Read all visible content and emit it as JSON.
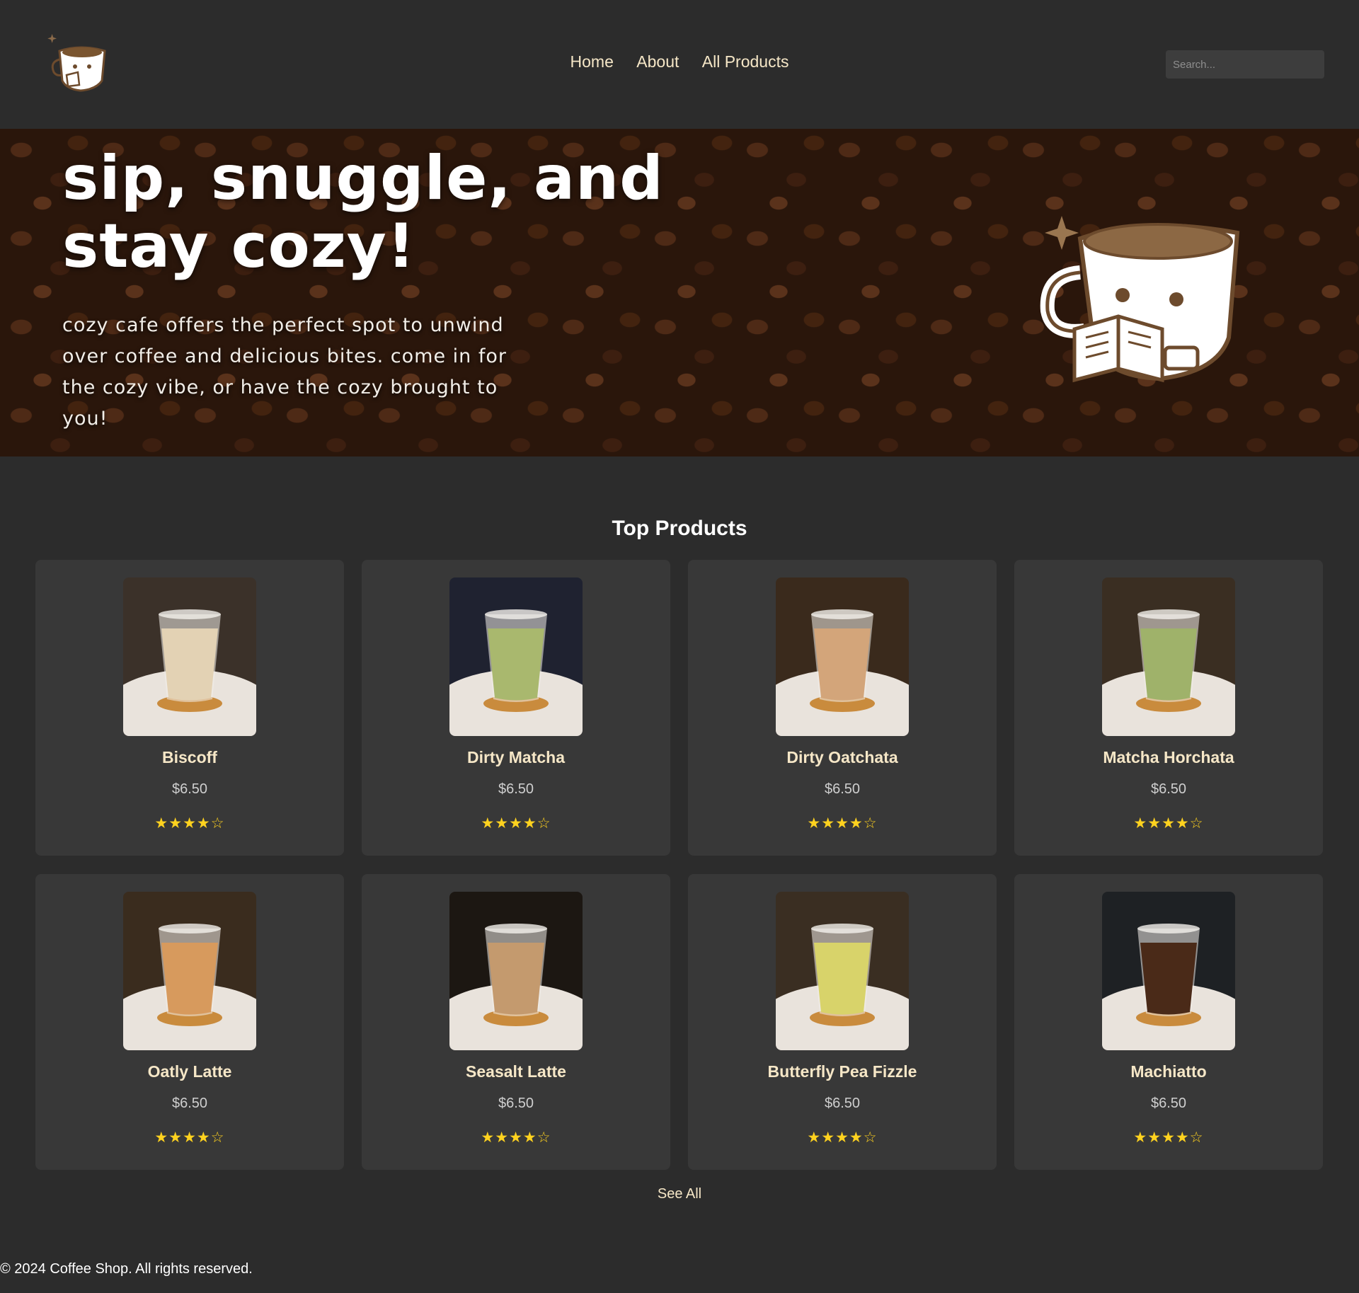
{
  "nav": {
    "items": [
      "Home",
      "About",
      "All Products"
    ]
  },
  "search": {
    "placeholder": "Search..."
  },
  "hero": {
    "title": "sip, snuggle, and stay cozy!",
    "text": "cozy cafe offers the perfect spot to unwind over coffee and delicious bites. come in for the cozy vibe, or have the cozy brought to you!"
  },
  "products": {
    "title": "Top Products",
    "items": [
      {
        "name": "Biscoff",
        "price": "$6.50",
        "rating": 4,
        "drink_color": "#e3d2b4",
        "bg": "#3b3129"
      },
      {
        "name": "Dirty Matcha",
        "price": "$6.50",
        "rating": 4,
        "drink_color": "#a9b86e",
        "bg": "#1f2230"
      },
      {
        "name": "Dirty Oatchata",
        "price": "$6.50",
        "rating": 4,
        "drink_color": "#d3a57a",
        "bg": "#3a2a1c"
      },
      {
        "name": "Matcha Horchata",
        "price": "$6.50",
        "rating": 4,
        "drink_color": "#9fb26a",
        "bg": "#3a2e22"
      },
      {
        "name": "Oatly Latte",
        "price": "$6.50",
        "rating": 4,
        "drink_color": "#d79a5d",
        "bg": "#3a2c1e"
      },
      {
        "name": "Seasalt Latte",
        "price": "$6.50",
        "rating": 4,
        "drink_color": "#c49a6e",
        "bg": "#1c1712"
      },
      {
        "name": "Butterfly Pea Fizzle",
        "price": "$6.50",
        "rating": 4,
        "drink_color": "#d8d36a",
        "bg": "#3a2e22"
      },
      {
        "name": "Machiatto",
        "price": "$6.50",
        "rating": 4,
        "drink_color": "#4a2a18",
        "bg": "#1e2124"
      }
    ],
    "see_all": "See All"
  },
  "footer": {
    "text": "© 2024 Coffee Shop. All rights reserved."
  },
  "colors": {
    "background": "#2c2c2c",
    "card": "#383838",
    "accent": "#f6e7c7",
    "star": "#ffd21f"
  }
}
